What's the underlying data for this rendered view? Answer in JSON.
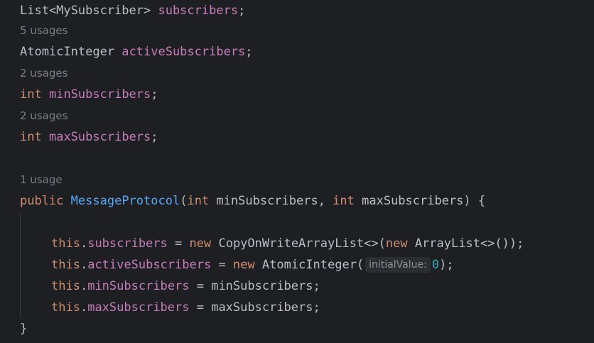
{
  "code": {
    "l1": {
      "type": "List<MySubscriber> ",
      "name": "subscribers",
      "end": ";"
    },
    "h2": "5 usages",
    "l3": {
      "type": "AtomicInteger ",
      "name": "activeSubscribers",
      "end": ";"
    },
    "h4": "2 usages",
    "l5": {
      "kw": "int",
      "sp": " ",
      "name": "minSubscribers",
      "end": ";"
    },
    "h6": "2 usages",
    "l7": {
      "kw": "int",
      "sp": " ",
      "name": "maxSubscribers",
      "end": ";"
    },
    "h8": "1 usage",
    "l9": {
      "kw_public": "public",
      "sp": " ",
      "method": "MessageProtocol",
      "open": "(",
      "kw_int1": "int",
      "param1": " minSubscribers, ",
      "kw_int2": "int",
      "param2": " maxSubscribers) {"
    },
    "l10": {
      "this": "this",
      "dot": ".",
      "field": "subscribers",
      "eq": " = ",
      "kw_new": "new",
      "ctor": " CopyOnWriteArrayList<>(",
      "kw_new2": "new",
      "rest": " ArrayList<>());"
    },
    "l11": {
      "this": "this",
      "dot": ".",
      "field": "activeSubscribers",
      "eq": " = ",
      "kw_new": "new",
      "ctor": " AtomicInteger(",
      "hint": "initialValue:",
      "num": "0",
      "end": ");"
    },
    "l12": {
      "this": "this",
      "dot": ".",
      "field": "minSubscribers",
      "rest": " = minSubscribers;"
    },
    "l13": {
      "this": "this",
      "dot": ".",
      "field": "maxSubscribers",
      "rest": " = maxSubscribers;"
    },
    "l14": "}"
  },
  "colors": {
    "background": "#1e1f22",
    "keyword": "#cf8e6d",
    "field": "#c77dbb",
    "method": "#56a8f5",
    "number": "#2aacb8",
    "text": "#bcbec4",
    "hint": "#7a7e85"
  }
}
